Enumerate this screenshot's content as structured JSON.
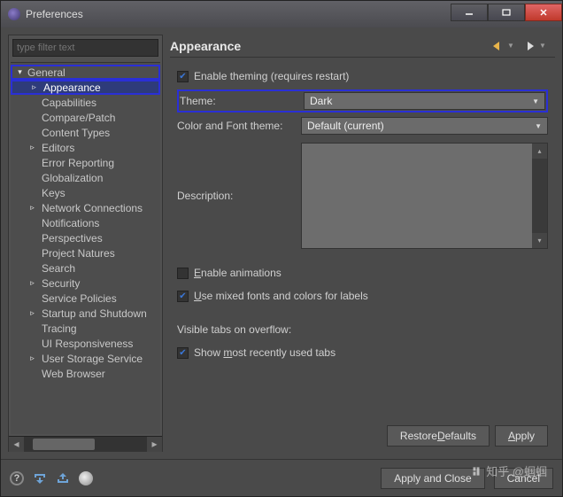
{
  "window": {
    "title": "Preferences"
  },
  "sidebar": {
    "filter_placeholder": "type filter text",
    "items": [
      {
        "label": "General",
        "level": 0,
        "expander": "▾",
        "hl": true
      },
      {
        "label": "Appearance",
        "level": 1,
        "expander": "▹",
        "selected": true,
        "hl": true
      },
      {
        "label": "Capabilities",
        "level": 1,
        "expander": ""
      },
      {
        "label": "Compare/Patch",
        "level": 1,
        "expander": ""
      },
      {
        "label": "Content Types",
        "level": 1,
        "expander": ""
      },
      {
        "label": "Editors",
        "level": 1,
        "expander": "▹"
      },
      {
        "label": "Error Reporting",
        "level": 1,
        "expander": ""
      },
      {
        "label": "Globalization",
        "level": 1,
        "expander": ""
      },
      {
        "label": "Keys",
        "level": 1,
        "expander": ""
      },
      {
        "label": "Network Connections",
        "level": 1,
        "expander": "▹"
      },
      {
        "label": "Notifications",
        "level": 1,
        "expander": ""
      },
      {
        "label": "Perspectives",
        "level": 1,
        "expander": ""
      },
      {
        "label": "Project Natures",
        "level": 1,
        "expander": ""
      },
      {
        "label": "Search",
        "level": 1,
        "expander": ""
      },
      {
        "label": "Security",
        "level": 1,
        "expander": "▹"
      },
      {
        "label": "Service Policies",
        "level": 1,
        "expander": ""
      },
      {
        "label": "Startup and Shutdown",
        "level": 1,
        "expander": "▹"
      },
      {
        "label": "Tracing",
        "level": 1,
        "expander": ""
      },
      {
        "label": "UI Responsiveness",
        "level": 1,
        "expander": ""
      },
      {
        "label": "User Storage Service",
        "level": 1,
        "expander": "▹"
      },
      {
        "label": "Web Browser",
        "level": 1,
        "expander": ""
      }
    ]
  },
  "main": {
    "heading": "Appearance",
    "enable_theming": "Enable theming (requires restart)",
    "theme_label": "Theme:",
    "theme_value": "Dark",
    "colorfont_label": "Color and Font theme:",
    "colorfont_value": "Default (current)",
    "description_label": "Description:",
    "enable_animations": "Enable animations",
    "mixed_fonts": "Use mixed fonts and colors for labels",
    "visible_tabs_label": "Visible tabs on overflow:",
    "show_mru": "Show most recently used tabs",
    "restore_defaults": "Restore Defaults",
    "apply": "Apply",
    "apply_close": "Apply and Close",
    "cancel": "Cancel"
  },
  "watermark": "知乎 @蝈蝈"
}
